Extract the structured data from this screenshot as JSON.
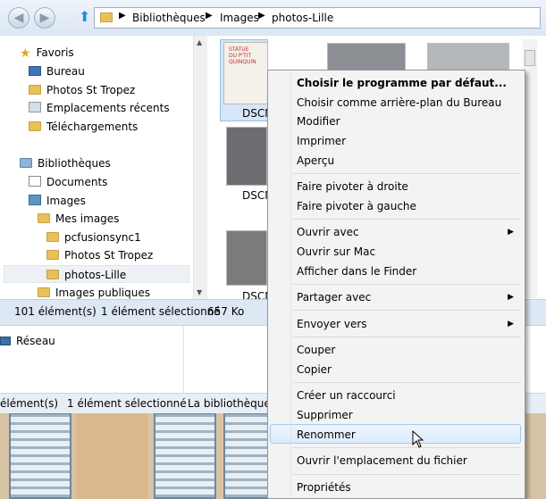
{
  "nav": {
    "breadcrumb": [
      "Bibliothèques",
      "Images",
      "photos-Lille"
    ]
  },
  "tree": {
    "favorites": "Favoris",
    "bureau": "Bureau",
    "photos_st_tropez": "Photos St Tropez",
    "recent": "Emplacements récents",
    "downloads": "Téléchargements",
    "libraries": "Bibliothèques",
    "documents": "Documents",
    "images": "Images",
    "my_images": "Mes images",
    "pcfusionsync": "pcfusionsync1",
    "photos_st_tropez_2": "Photos St Tropez",
    "photos_lille": "photos-Lille",
    "public_images": "Images publiques"
  },
  "files": {
    "item1": "DSCN",
    "item2": "DSCN",
    "item3": "DSCN",
    "sign_line1": "STATUE",
    "sign_line2": "DU P'TIT QUINQUIN"
  },
  "status": {
    "count": "101 élément(s)",
    "selected": "1 élément sélectionné",
    "size": "657 Ko"
  },
  "back_window": {
    "network": "Réseau",
    "count": "élément(s)",
    "selected": "1 élément sélectionné",
    "library": "La bibliothèque i"
  },
  "context_menu": {
    "choose_default": "Choisir le programme par défaut...",
    "set_wallpaper": "Choisir comme arrière-plan du Bureau",
    "edit": "Modifier",
    "print": "Imprimer",
    "preview": "Aperçu",
    "rotate_right": "Faire pivoter à droite",
    "rotate_left": "Faire pivoter à gauche",
    "open_with": "Ouvrir avec",
    "open_on_mac": "Ouvrir sur Mac",
    "show_in_finder": "Afficher dans le Finder",
    "share_with": "Partager avec",
    "send_to": "Envoyer vers",
    "cut": "Couper",
    "copy": "Copier",
    "create_shortcut": "Créer un raccourci",
    "delete": "Supprimer",
    "rename": "Renommer",
    "open_location": "Ouvrir l'emplacement du fichier",
    "properties": "Propriétés"
  },
  "colors": {
    "accent": "#3399ff",
    "folder": "#e8c15a",
    "highlight": "#dcebfc"
  }
}
